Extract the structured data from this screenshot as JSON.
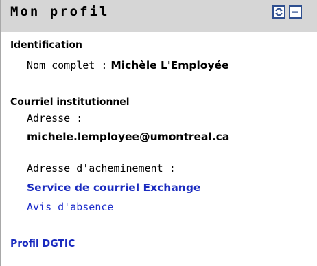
{
  "header": {
    "title": "Mon profil",
    "refresh_icon": "refresh-icon",
    "minimize_icon": "minimize-icon"
  },
  "identification": {
    "title": "Identification",
    "full_name_label": "Nom complet :",
    "full_name_value": "Michèle L'Employée"
  },
  "email": {
    "title": "Courriel institutionnel",
    "address_label": "Adresse :",
    "address_value": "michele.lemployee@umontreal.ca",
    "routing_label": "Adresse d'acheminement :",
    "routing_link": "Service de courriel Exchange",
    "absence_link": "Avis d'absence"
  },
  "profile_link": "Profil DGTIC",
  "colors": {
    "header_bg": "#d6d6d6",
    "link": "#1e2ecb",
    "icon_border": "#2f4f8f"
  }
}
